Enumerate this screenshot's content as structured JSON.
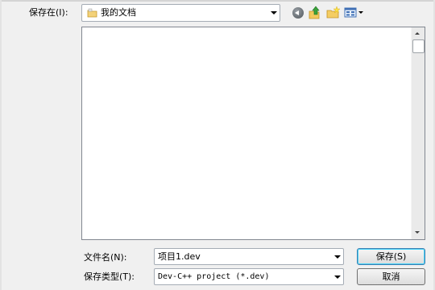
{
  "dialog": {
    "save_in_label": "保存在(I):",
    "location": {
      "value": "我的文档",
      "icon": "folder-icon"
    },
    "toolbar": {
      "back_icon": "back-icon",
      "up_icon": "up-folder-icon",
      "new_folder_icon": "new-folder-icon",
      "view_icon": "view-menu-icon"
    },
    "file_list": [],
    "filename": {
      "label": "文件名(N):",
      "value": "项目1.dev"
    },
    "filetype": {
      "label": "保存类型(T):",
      "value": "Dev-C++ project (*.dev)"
    },
    "buttons": {
      "save": "保存(S)",
      "cancel": "取消"
    }
  },
  "colors": {
    "accent_border": "#3c7fb1",
    "pane_border": "#828790",
    "background": "#f0f0f0"
  }
}
